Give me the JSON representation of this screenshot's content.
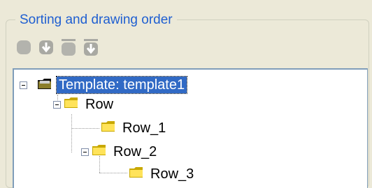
{
  "group": {
    "title": "Sorting and drawing order"
  },
  "toolbar": {
    "buttons": [
      {
        "name": "move-top",
        "icon": "bring-to-front-icon",
        "enabled": false
      },
      {
        "name": "move-down",
        "icon": "move-down-icon",
        "enabled": false
      },
      {
        "name": "move-bottom",
        "icon": "send-to-back-icon",
        "enabled": false
      },
      {
        "name": "move-down-alt",
        "icon": "move-down-icon",
        "enabled": false
      }
    ]
  },
  "tree": {
    "nodes": [
      {
        "label": "Template: template1",
        "icon": "template-folder-icon",
        "expanded": true,
        "selected": true
      },
      {
        "label": "Row",
        "icon": "folder-icon",
        "expanded": true
      },
      {
        "label": "Row_1",
        "icon": "folder-icon"
      },
      {
        "label": "Row_2",
        "icon": "folder-icon",
        "expanded": true
      },
      {
        "label": "Row_3",
        "icon": "folder-icon"
      }
    ]
  },
  "colors": {
    "legend_text": "#1f5fd1",
    "selection": "#316ac5",
    "tree_border": "#7f9db9",
    "folder": "#ffe35a"
  }
}
